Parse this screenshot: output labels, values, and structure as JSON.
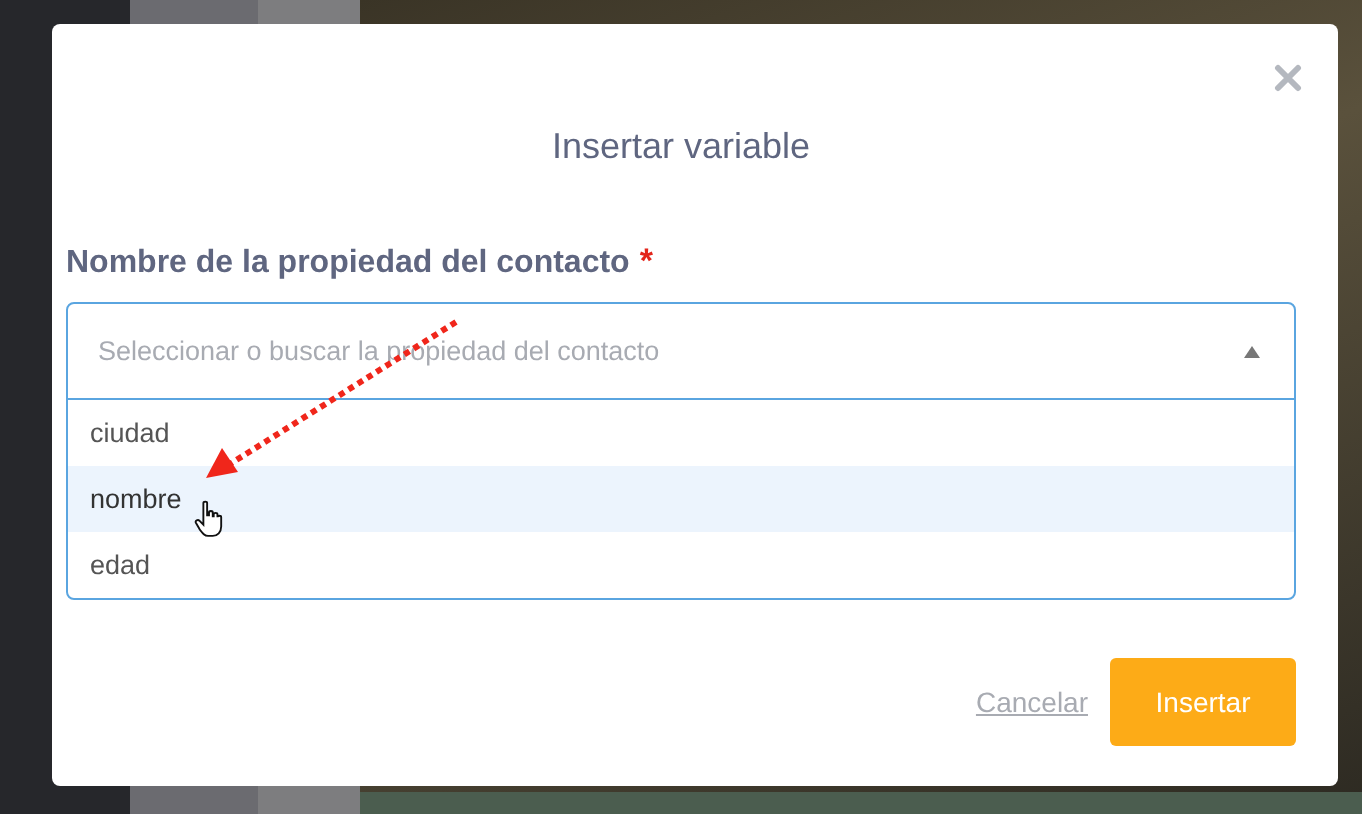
{
  "dialog": {
    "title": "Insertar variable"
  },
  "field": {
    "label": "Nombre de la propiedad del contacto",
    "required_mark": "*",
    "placeholder": "Seleccionar o buscar la propiedad del contacto",
    "expanded": true,
    "options": [
      {
        "label": "ciudad",
        "selected": false
      },
      {
        "label": "nombre",
        "selected": true
      },
      {
        "label": "edad",
        "selected": false
      }
    ]
  },
  "buttons": [
    {
      "kind": "link",
      "label": "Cancelar"
    },
    {
      "kind": "primary",
      "label": "Insertar"
    }
  ]
}
